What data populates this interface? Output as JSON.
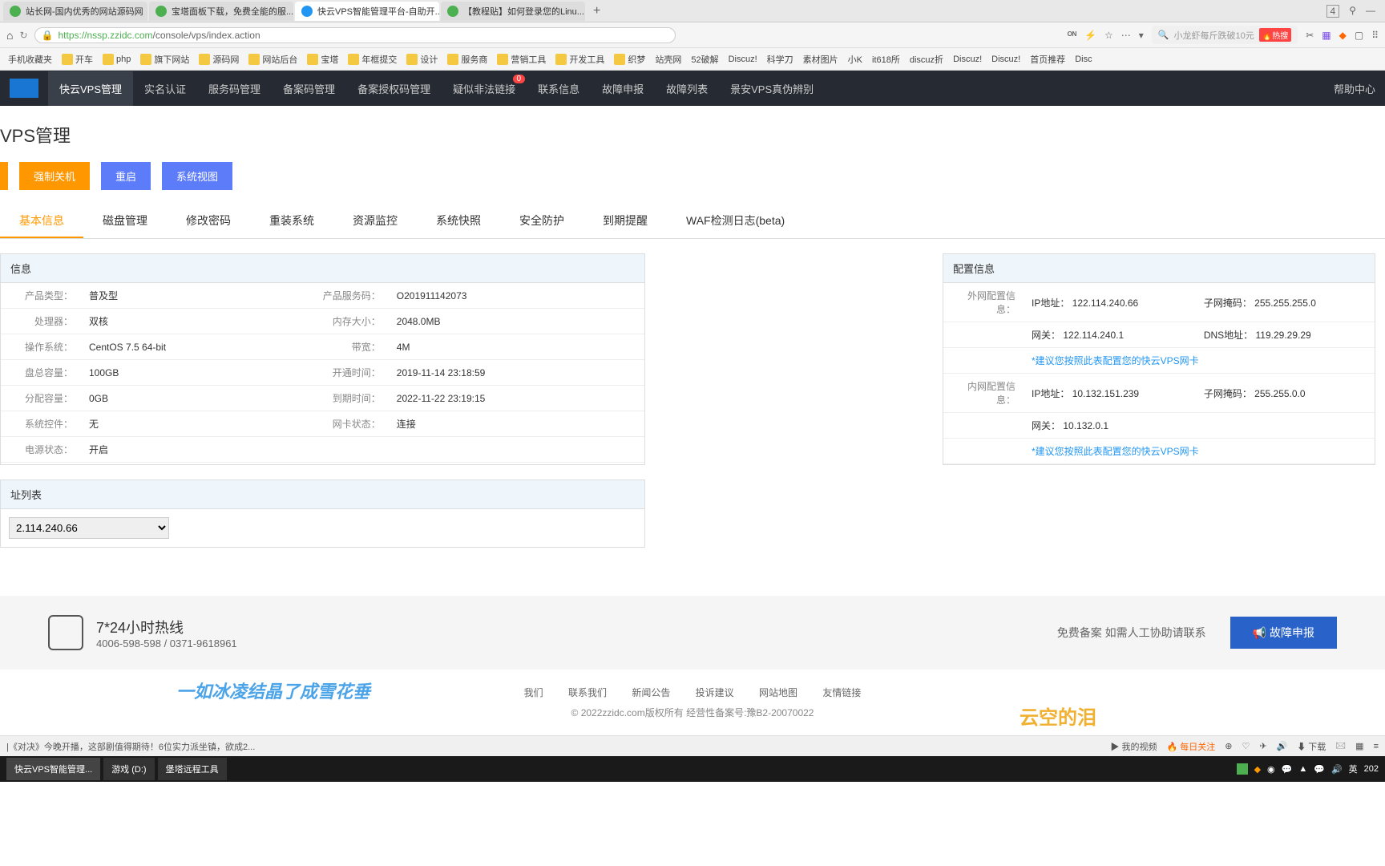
{
  "browser": {
    "tabs": [
      {
        "title": "站长网-国内优秀的网站源码网",
        "active": false
      },
      {
        "title": "宝塔面板下载，免费全能的服...",
        "active": false
      },
      {
        "title": "快云VPS智能管理平台-自助开...",
        "active": true
      },
      {
        "title": "【教程贴】如何登录您的Linu...",
        "active": false
      }
    ],
    "url_host": "https://nssp.zzidc.com",
    "url_path": "/console/vps/index.action",
    "search_placeholder": "小龙虾每斤跌破10元",
    "hot_label": "热搜",
    "window_badge": "4"
  },
  "bookmarks": [
    "手机收藏夹",
    "开车",
    "php",
    "旗下网站",
    "源码网",
    "网站后台",
    "宝塔",
    "年框提交",
    "设计",
    "服务商",
    "营销工具",
    "开发工具",
    "织梦",
    "站壳网",
    "52破解",
    "Discuz!",
    "科学刀",
    "素材图片",
    "小K",
    "it618所",
    "discuz折",
    "Discuz!",
    "Discuz!",
    "首页推荐",
    "Disc"
  ],
  "nav": {
    "items": [
      "快云VPS管理",
      "实名认证",
      "服务码管理",
      "备案码管理",
      "备案授权码管理",
      "疑似非法链接",
      "联系信息",
      "故障申报",
      "故障列表",
      "景安VPS真伪辨别"
    ],
    "badge_index": 5,
    "badge_value": "0",
    "help": "帮助中心"
  },
  "page": {
    "title": "VPS管理",
    "buttons": [
      "",
      "强制关机",
      "重启",
      "系统视图"
    ],
    "sub_tabs": [
      "基本信息",
      "磁盘管理",
      "修改密码",
      "重装系统",
      "资源监控",
      "系统快照",
      "安全防护",
      "到期提醒",
      "WAF检测日志(beta)"
    ]
  },
  "info_panel": {
    "header": "信息",
    "rows_left": [
      {
        "label": "产品类型：",
        "value": "普及型"
      },
      {
        "label": "处理器：",
        "value": "双核"
      },
      {
        "label": "操作系统：",
        "value": "CentOS 7.5 64-bit"
      },
      {
        "label": "盘总容量：",
        "value": "100GB"
      },
      {
        "label": "分配容量：",
        "value": "0GB"
      },
      {
        "label": "系统控件：",
        "value": "无"
      },
      {
        "label": "电源状态：",
        "value": "开启",
        "link": true
      }
    ],
    "rows_right": [
      {
        "label": "产品服务码：",
        "value": "O201911142073"
      },
      {
        "label": "内存大小：",
        "value": "2048.0MB"
      },
      {
        "label": "带宽：",
        "value": "4M"
      },
      {
        "label": "开通时间：",
        "value": "2019-11-14 23:18:59"
      },
      {
        "label": "到期时间：",
        "value": "2022-11-22 23:19:15"
      },
      {
        "label": "网卡状态：",
        "value": "连接",
        "link": true
      }
    ]
  },
  "config_panel": {
    "header": "配置信息",
    "external_label": "外网配置信息：",
    "internal_label": "内网配置信息：",
    "ip_label": "IP地址：",
    "mask_label": "子网掩码：",
    "gateway_label": "网关：",
    "dns_label": "DNS地址：",
    "ext_ip": "122.114.240.66",
    "ext_mask": "255.255.255.0",
    "ext_gw": "122.114.240.1",
    "ext_dns": "119.29.29.29",
    "int_ip": "10.132.151.239",
    "int_mask": "255.255.0.0",
    "int_gw": "10.132.0.1",
    "note": "*建议您按照此表配置您的快云VPS网卡"
  },
  "ip_list": {
    "header": "址列表",
    "selected": "2.114.240.66"
  },
  "footer": {
    "hotline_title": "7*24小时热线",
    "hotline_nums": "4006-598-598 / 0371-9618961",
    "free_text": "免费备案 如需人工协助请联系",
    "report_btn": "故障申报",
    "links": [
      "我们",
      "联系我们",
      "新闻公告",
      "投诉建议",
      "网站地图",
      "友情链接"
    ],
    "copyright": "© 2022zzidc.com版权所有 经营性备案号:豫B2-20070022",
    "watermark1": "一如冰凌结晶了成雪花垂",
    "watermark2": "云空的泪"
  },
  "bottom_bar": {
    "news": "|《对决》今晚开播，这部剧值得期待！6位实力派坐镇，欲成2...",
    "items": [
      "我的视频",
      "每日关注",
      "下载"
    ]
  },
  "taskbar": {
    "items": [
      "快云VPS智能管理...",
      "游戏 (D:)",
      "堡塔远程工具"
    ],
    "ime": "英",
    "time_partial": "202"
  }
}
